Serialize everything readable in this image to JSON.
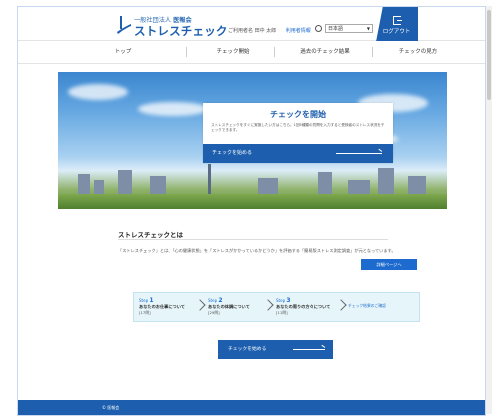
{
  "header": {
    "logo_line1": "一般社団法人",
    "logo_line1_org": "医報会",
    "logo_line2": "ストレスチェック",
    "greeting": "ご利用者名 田中 太郎",
    "account_link": "利用者情報",
    "language": "日本語",
    "logout_label": "ログアウト"
  },
  "nav": {
    "items": [
      "トップ",
      "チェック開始",
      "過去のチェック結果",
      "チェックの見方"
    ]
  },
  "hero": {
    "title": "チェックを開始",
    "description": "ストレスチェックをすぐに実施したい方はこちら。1回5種類の質問を入力すると受検者のストレス状況をチェックできます。",
    "button_label": "チェックを始める"
  },
  "about": {
    "title": "ストレスチェックとは",
    "description": "「ストレスチェック」とは、「心の健康状態」を「ストレスがかかっているかどうか」を評価する「簡易版ストレス測定調査」が元となっています。",
    "detail_button": "詳細ページへ"
  },
  "steps": [
    {
      "label": "Step",
      "num": "1",
      "title": "あなたのお仕事について",
      "meta": "[17問]"
    },
    {
      "label": "Step",
      "num": "2",
      "title": "あなたの体調について",
      "meta": "[29問]"
    },
    {
      "label": "Step",
      "num": "3",
      "title": "あなたの周りの方々について",
      "meta": "[11問]"
    }
  ],
  "steps_link": "チェック結果のご確認",
  "start_button": "チェックを始める",
  "footer": {
    "text": "© 医報会"
  },
  "colors": {
    "brand": "#1d5fae",
    "accent": "#1d6bcf",
    "steps_bg": "#e6f5f9"
  }
}
